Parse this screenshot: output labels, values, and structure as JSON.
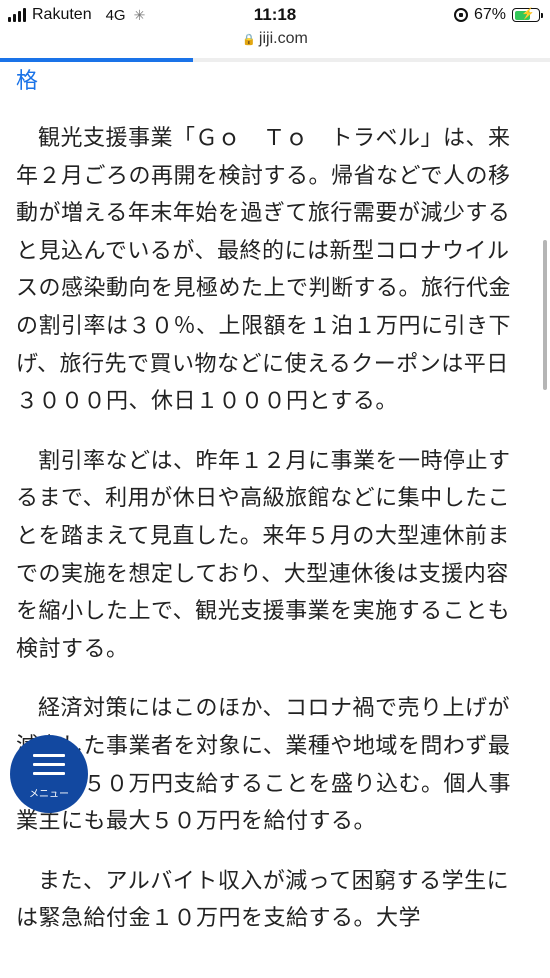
{
  "status_bar": {
    "carrier": "Rakuten",
    "network": "4G",
    "time": "11:18",
    "battery_percent": "67%",
    "battery_level": 0.67,
    "icons": [
      "signal-icon",
      "loading-spinner-icon",
      "rotation-lock-icon",
      "battery-charging-icon"
    ]
  },
  "browser": {
    "url": "jiji.com",
    "load_progress": 0.35,
    "accent_color": "#1a73e8"
  },
  "article": {
    "tail_text": "格",
    "paragraphs": [
      "観光支援事業「Ｇｏ　Ｔｏ　トラベル」は、来年２月ごろの再開を検討する。帰省などで人の移動が増える年末年始を過ぎて旅行需要が減少すると見込んでいるが、最終的には新型コロナウイルスの感染動向を見極めた上で判断する。旅行代金の割引率は３０％、上限額を１泊１万円に引き下げ、旅行先で買い物などに使えるクーポンは平日３０００円、休日１０００円とする。",
      "割引率などは、昨年１２月に事業を一時停止するまで、利用が休日や高級旅館などに集中したことを踏まえて見直した。来年５月の大型連休前までの実施を想定しており、大型連休後は支援内容を縮小した上で、観光支援事業を実施することも検討する。",
      "経済対策にはこのほか、コロナ禍で売り上げが減少した事業者を対象に、業種や地域を問わず最大で２５０万円支給することを盛り込む。個人事業主にも最大５０万円を給付する。",
      "また、アルバイト収入が減って困窮する学生には緊急給付金１０万円を支給する。大学"
    ]
  },
  "menu_button": {
    "label": "メニュー",
    "color": "#1248a0"
  }
}
